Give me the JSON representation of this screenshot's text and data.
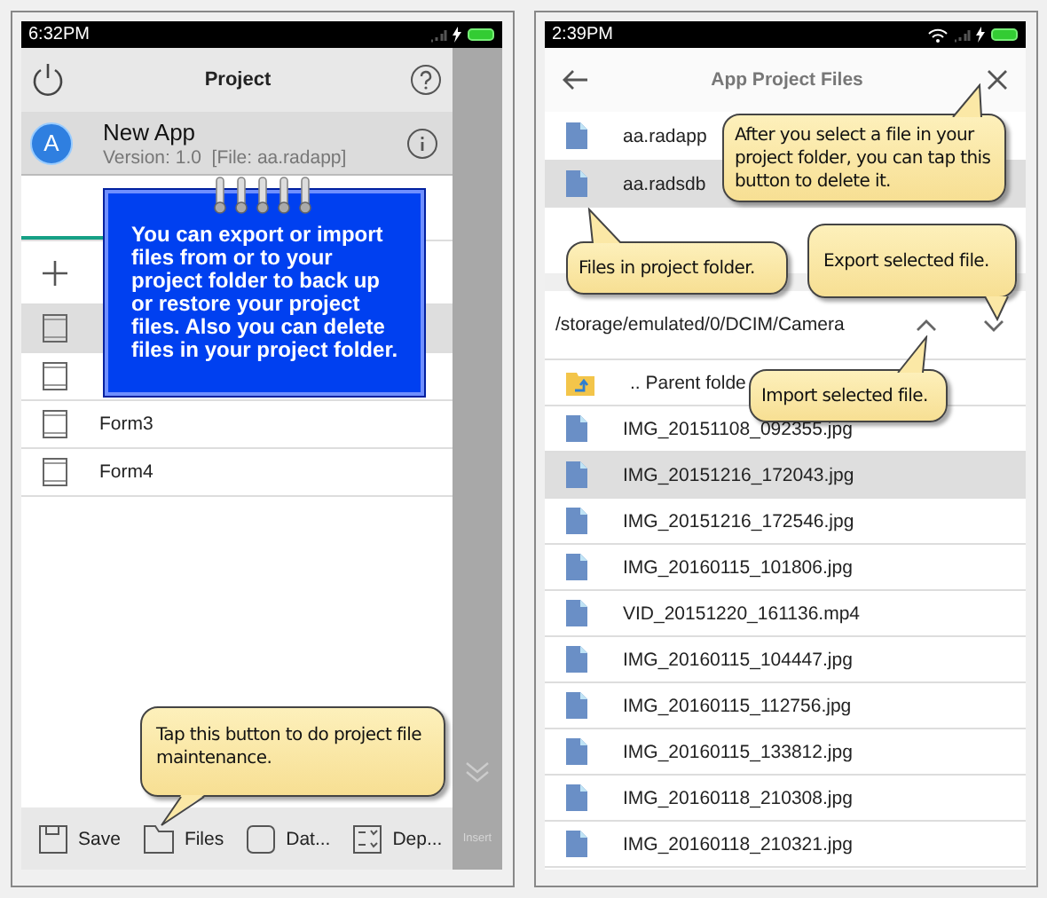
{
  "left_screen": {
    "status_bar": {
      "time": "6:32PM"
    },
    "header": {
      "title": "Project"
    },
    "app": {
      "avatar_letter": "A",
      "name": "New App",
      "details": "Version: 1.0  [File: aa.radapp]"
    },
    "forms": [
      {
        "selected": true
      },
      {
        "selected": false
      },
      {
        "label": "Form3",
        "selected": false
      },
      {
        "label": "Form4",
        "selected": false
      }
    ],
    "toolbar": [
      {
        "kind": "save",
        "label": "Save"
      },
      {
        "kind": "files",
        "label": "Files"
      },
      {
        "kind": "data",
        "label": "Dat..."
      },
      {
        "kind": "deploy",
        "label": "Dep..."
      }
    ],
    "side_strip": {
      "label": "Insert"
    },
    "note": {
      "text": "You can export or import files from or to your project folder to back up or restore your project files. Also you can delete files in your project folder."
    },
    "callout": {
      "text": "Tap this button to do project file maintenance."
    }
  },
  "right_screen": {
    "status_bar": {
      "time": "2:39PM"
    },
    "header": {
      "title": "App Project Files"
    },
    "project_files": [
      {
        "name": "aa.radapp",
        "selected": false
      },
      {
        "name": "aa.radsdb",
        "selected": true
      }
    ],
    "path": "/storage/emulated/0/DCIM/Camera",
    "folder_items": [
      {
        "kind": "parent",
        "name": ".. Parent folde",
        "selected": false
      },
      {
        "kind": "file",
        "name": "IMG_20151108_092355.jpg",
        "selected": false
      },
      {
        "kind": "file",
        "name": "IMG_20151216_172043.jpg",
        "selected": true
      },
      {
        "kind": "file",
        "name": "IMG_20151216_172546.jpg",
        "selected": false
      },
      {
        "kind": "file",
        "name": "IMG_20160115_101806.jpg",
        "selected": false
      },
      {
        "kind": "file",
        "name": "VID_20151220_161136.mp4",
        "selected": false
      },
      {
        "kind": "file",
        "name": "IMG_20160115_104447.jpg",
        "selected": false
      },
      {
        "kind": "file",
        "name": "IMG_20160115_112756.jpg",
        "selected": false
      },
      {
        "kind": "file",
        "name": "IMG_20160115_133812.jpg",
        "selected": false
      },
      {
        "kind": "file",
        "name": "IMG_20160118_210308.jpg",
        "selected": false
      },
      {
        "kind": "file",
        "name": "IMG_20160118_210321.jpg",
        "selected": false
      }
    ],
    "callouts": [
      {
        "text": "After you select a file in your project folder, you can tap this button to delete it."
      },
      {
        "text": "Files in project folder."
      },
      {
        "text": "Export selected file."
      },
      {
        "text": "Import selected file."
      }
    ]
  }
}
